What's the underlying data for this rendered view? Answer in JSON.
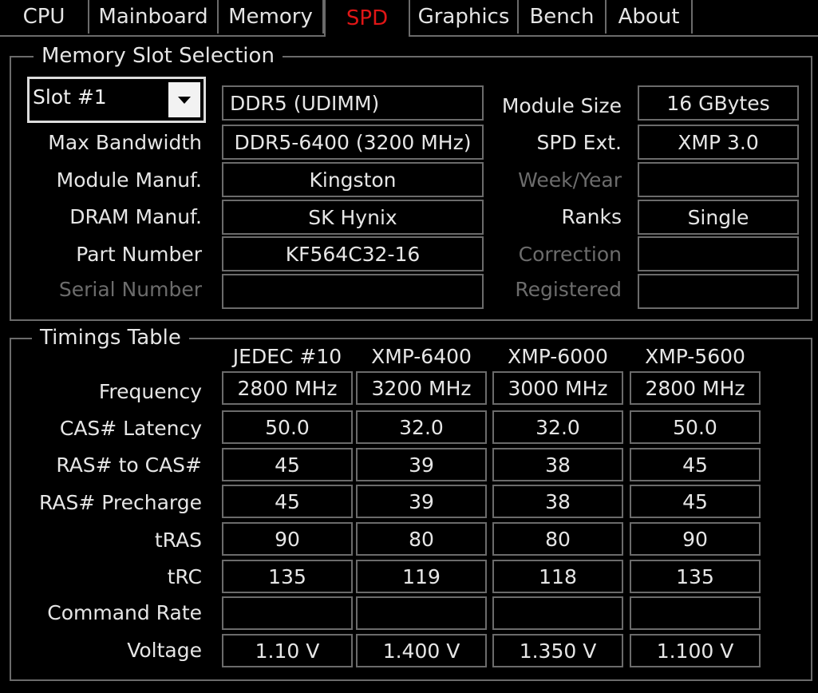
{
  "tabs": [
    {
      "label": "CPU"
    },
    {
      "label": "Mainboard"
    },
    {
      "label": "Memory"
    },
    {
      "label": "SPD"
    },
    {
      "label": "Graphics"
    },
    {
      "label": "Bench"
    },
    {
      "label": "About"
    }
  ],
  "active_tab_color": "#e01616",
  "slot_group": {
    "title": "Memory Slot Selection",
    "slot_value": "Slot #1",
    "dropdown_icon": "chevron-down-icon",
    "memory_type": "DDR5 (UDIMM)",
    "left_labels": {
      "max_bandwidth": "Max Bandwidth",
      "module_manuf": "Module Manuf.",
      "dram_manuf": "DRAM Manuf.",
      "part_number": "Part Number",
      "serial_number": "Serial Number"
    },
    "left_values": {
      "max_bandwidth": "DDR5-6400 (3200 MHz)",
      "module_manuf": "Kingston",
      "dram_manuf": "SK Hynix",
      "part_number": "KF564C32-16",
      "serial_number": ""
    },
    "right_labels": {
      "module_size": "Module Size",
      "spd_ext": "SPD Ext.",
      "week_year": "Week/Year",
      "ranks": "Ranks",
      "correction": "Correction",
      "registered": "Registered"
    },
    "right_values": {
      "module_size": "16 GBytes",
      "spd_ext": "XMP 3.0",
      "week_year": "",
      "ranks": "Single",
      "correction": "",
      "registered": ""
    }
  },
  "timings_group": {
    "title": "Timings Table",
    "columns": [
      "JEDEC #10",
      "XMP-6400",
      "XMP-6000",
      "XMP-5600"
    ],
    "rows": [
      {
        "label": "Frequency",
        "values": [
          "2800 MHz",
          "3200 MHz",
          "3000 MHz",
          "2800 MHz"
        ]
      },
      {
        "label": "CAS# Latency",
        "values": [
          "50.0",
          "32.0",
          "32.0",
          "50.0"
        ]
      },
      {
        "label": "RAS# to CAS#",
        "values": [
          "45",
          "39",
          "38",
          "45"
        ]
      },
      {
        "label": "RAS# Precharge",
        "values": [
          "45",
          "39",
          "38",
          "45"
        ]
      },
      {
        "label": "tRAS",
        "values": [
          "90",
          "80",
          "80",
          "90"
        ]
      },
      {
        "label": "tRC",
        "values": [
          "135",
          "119",
          "118",
          "135"
        ]
      },
      {
        "label": "Command Rate",
        "values": [
          "",
          "",
          "",
          ""
        ]
      },
      {
        "label": "Voltage",
        "values": [
          "1.10 V",
          "1.400 V",
          "1.350 V",
          "1.100 V"
        ]
      }
    ]
  }
}
